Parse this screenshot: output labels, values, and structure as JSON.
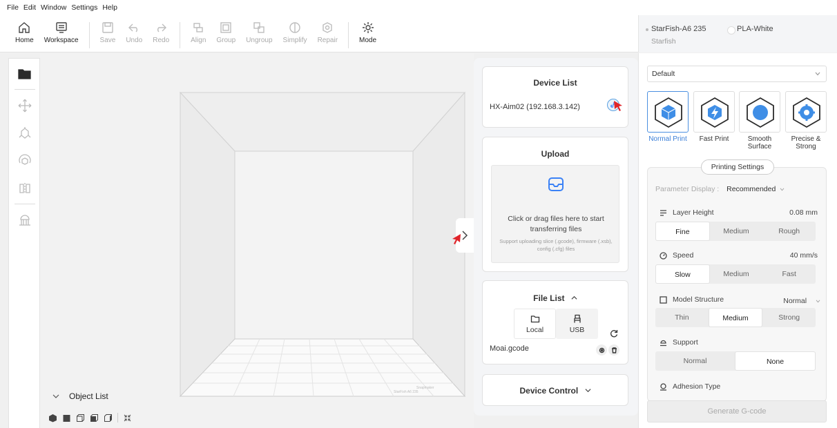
{
  "menu": [
    "File",
    "Edit",
    "Window",
    "Settings",
    "Help"
  ],
  "toolbar": {
    "buttons": [
      {
        "label": "Home",
        "icon": "home-icon",
        "enabled": true
      },
      {
        "label": "Workspace",
        "icon": "workspace-icon",
        "enabled": true
      },
      {
        "label": "Save",
        "icon": "save-icon",
        "enabled": false
      },
      {
        "label": "Undo",
        "icon": "undo-icon",
        "enabled": false
      },
      {
        "label": "Redo",
        "icon": "redo-icon",
        "enabled": false
      },
      {
        "label": "Align",
        "icon": "align-icon",
        "enabled": false
      },
      {
        "label": "Group",
        "icon": "group-icon",
        "enabled": false
      },
      {
        "label": "Ungroup",
        "icon": "ungroup-icon",
        "enabled": false
      },
      {
        "label": "Simplify",
        "icon": "simplify-icon",
        "enabled": false
      },
      {
        "label": "Repair",
        "icon": "repair-icon",
        "enabled": false
      },
      {
        "label": "Mode",
        "icon": "mode-icon",
        "enabled": true
      }
    ]
  },
  "printer": {
    "name": "StarFish-A6 235",
    "brand": "Starfish",
    "material": "PLA-White"
  },
  "left_tools": [
    "open-folder-icon",
    "move-icon",
    "scale-icon",
    "rotate-icon",
    "mirror-icon",
    "support-icon"
  ],
  "viewport": {
    "object_list_label": "Object List",
    "bed_text": [
      "Snapmaker",
      "StarFish A6 235"
    ]
  },
  "device": {
    "device_list_title": "Device List",
    "device_name": "HX-Aim02 (192.168.3.142)",
    "upload_title": "Upload",
    "upload_main": "Click or drag files here to start transferring files",
    "upload_sub": "Support uploading slice (.gcode), firmware (.xsb), config (.cfg) files",
    "file_list_title": "File List",
    "tab_local": "Local",
    "tab_usb": "USB",
    "file_name": "Moai.gcode",
    "device_control_title": "Device Control"
  },
  "settings": {
    "preset": "Default",
    "modes": [
      {
        "label": "Normal Print",
        "selected": true
      },
      {
        "label": "Fast Print",
        "selected": false
      },
      {
        "label": "Smooth Surface",
        "selected": false
      },
      {
        "label": "Precise & Strong",
        "selected": false
      }
    ],
    "printing_settings_label": "Printing Settings",
    "parameter_display_label": "Parameter Display :",
    "parameter_display_value": "Recommended",
    "layer_height": {
      "label": "Layer Height",
      "value": "0.08 mm",
      "options": [
        "Fine",
        "Medium",
        "Rough"
      ],
      "selected": 0
    },
    "speed": {
      "label": "Speed",
      "value": "40 mm/s",
      "options": [
        "Slow",
        "Medium",
        "Fast"
      ],
      "selected": 0
    },
    "model_structure": {
      "label": "Model Structure",
      "value": "Normal",
      "options": [
        "Thin",
        "Medium",
        "Strong"
      ],
      "selected": 1
    },
    "support": {
      "label": "Support",
      "options": [
        "Normal",
        "None"
      ],
      "selected": 1
    },
    "adhesion_label": "Adhesion Type",
    "generate_label": "Generate G-code"
  },
  "colors": {
    "accent": "#3b82f6",
    "cursor": "#e0242a"
  }
}
